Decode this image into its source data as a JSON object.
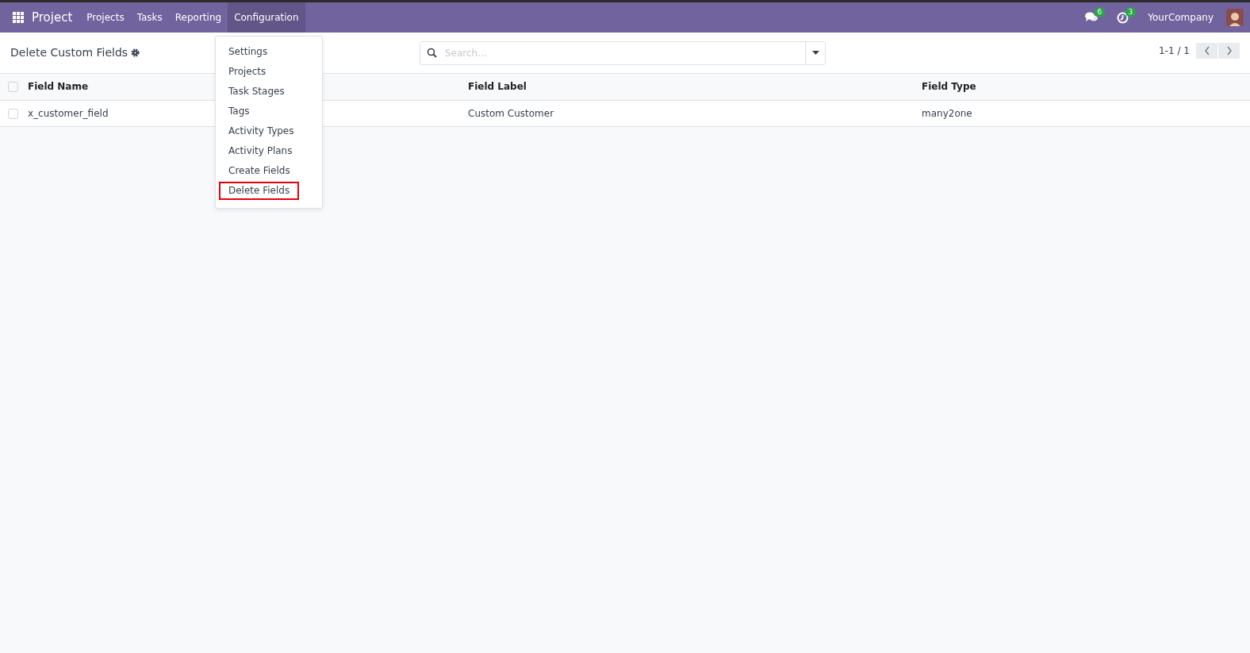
{
  "navbar": {
    "app": "Project",
    "menus": [
      {
        "label": "Projects",
        "selected": false
      },
      {
        "label": "Tasks",
        "selected": false
      },
      {
        "label": "Reporting",
        "selected": false
      },
      {
        "label": "Configuration",
        "selected": true
      }
    ],
    "messages_count": "6",
    "activities_count": "3",
    "company": "YourCompany"
  },
  "dropdown": {
    "items": [
      {
        "label": "Settings",
        "highlighted": false
      },
      {
        "label": "Projects",
        "highlighted": false
      },
      {
        "label": "Task Stages",
        "highlighted": false
      },
      {
        "label": "Tags",
        "highlighted": false
      },
      {
        "label": "Activity Types",
        "highlighted": false
      },
      {
        "label": "Activity Plans",
        "highlighted": false
      },
      {
        "label": "Create Fields",
        "highlighted": false
      },
      {
        "label": "Delete Fields",
        "highlighted": true
      }
    ]
  },
  "control_panel": {
    "title": "Delete Custom Fields",
    "search": {
      "placeholder": "Search..."
    },
    "pager": "1-1 / 1"
  },
  "table": {
    "select_all_checked": false,
    "columns": [
      "Field Name",
      "Field Label",
      "Field Type"
    ],
    "rows": [
      {
        "checked": false,
        "cells": [
          "x_customer_field",
          "Custom Customer",
          "many2one"
        ]
      }
    ]
  }
}
